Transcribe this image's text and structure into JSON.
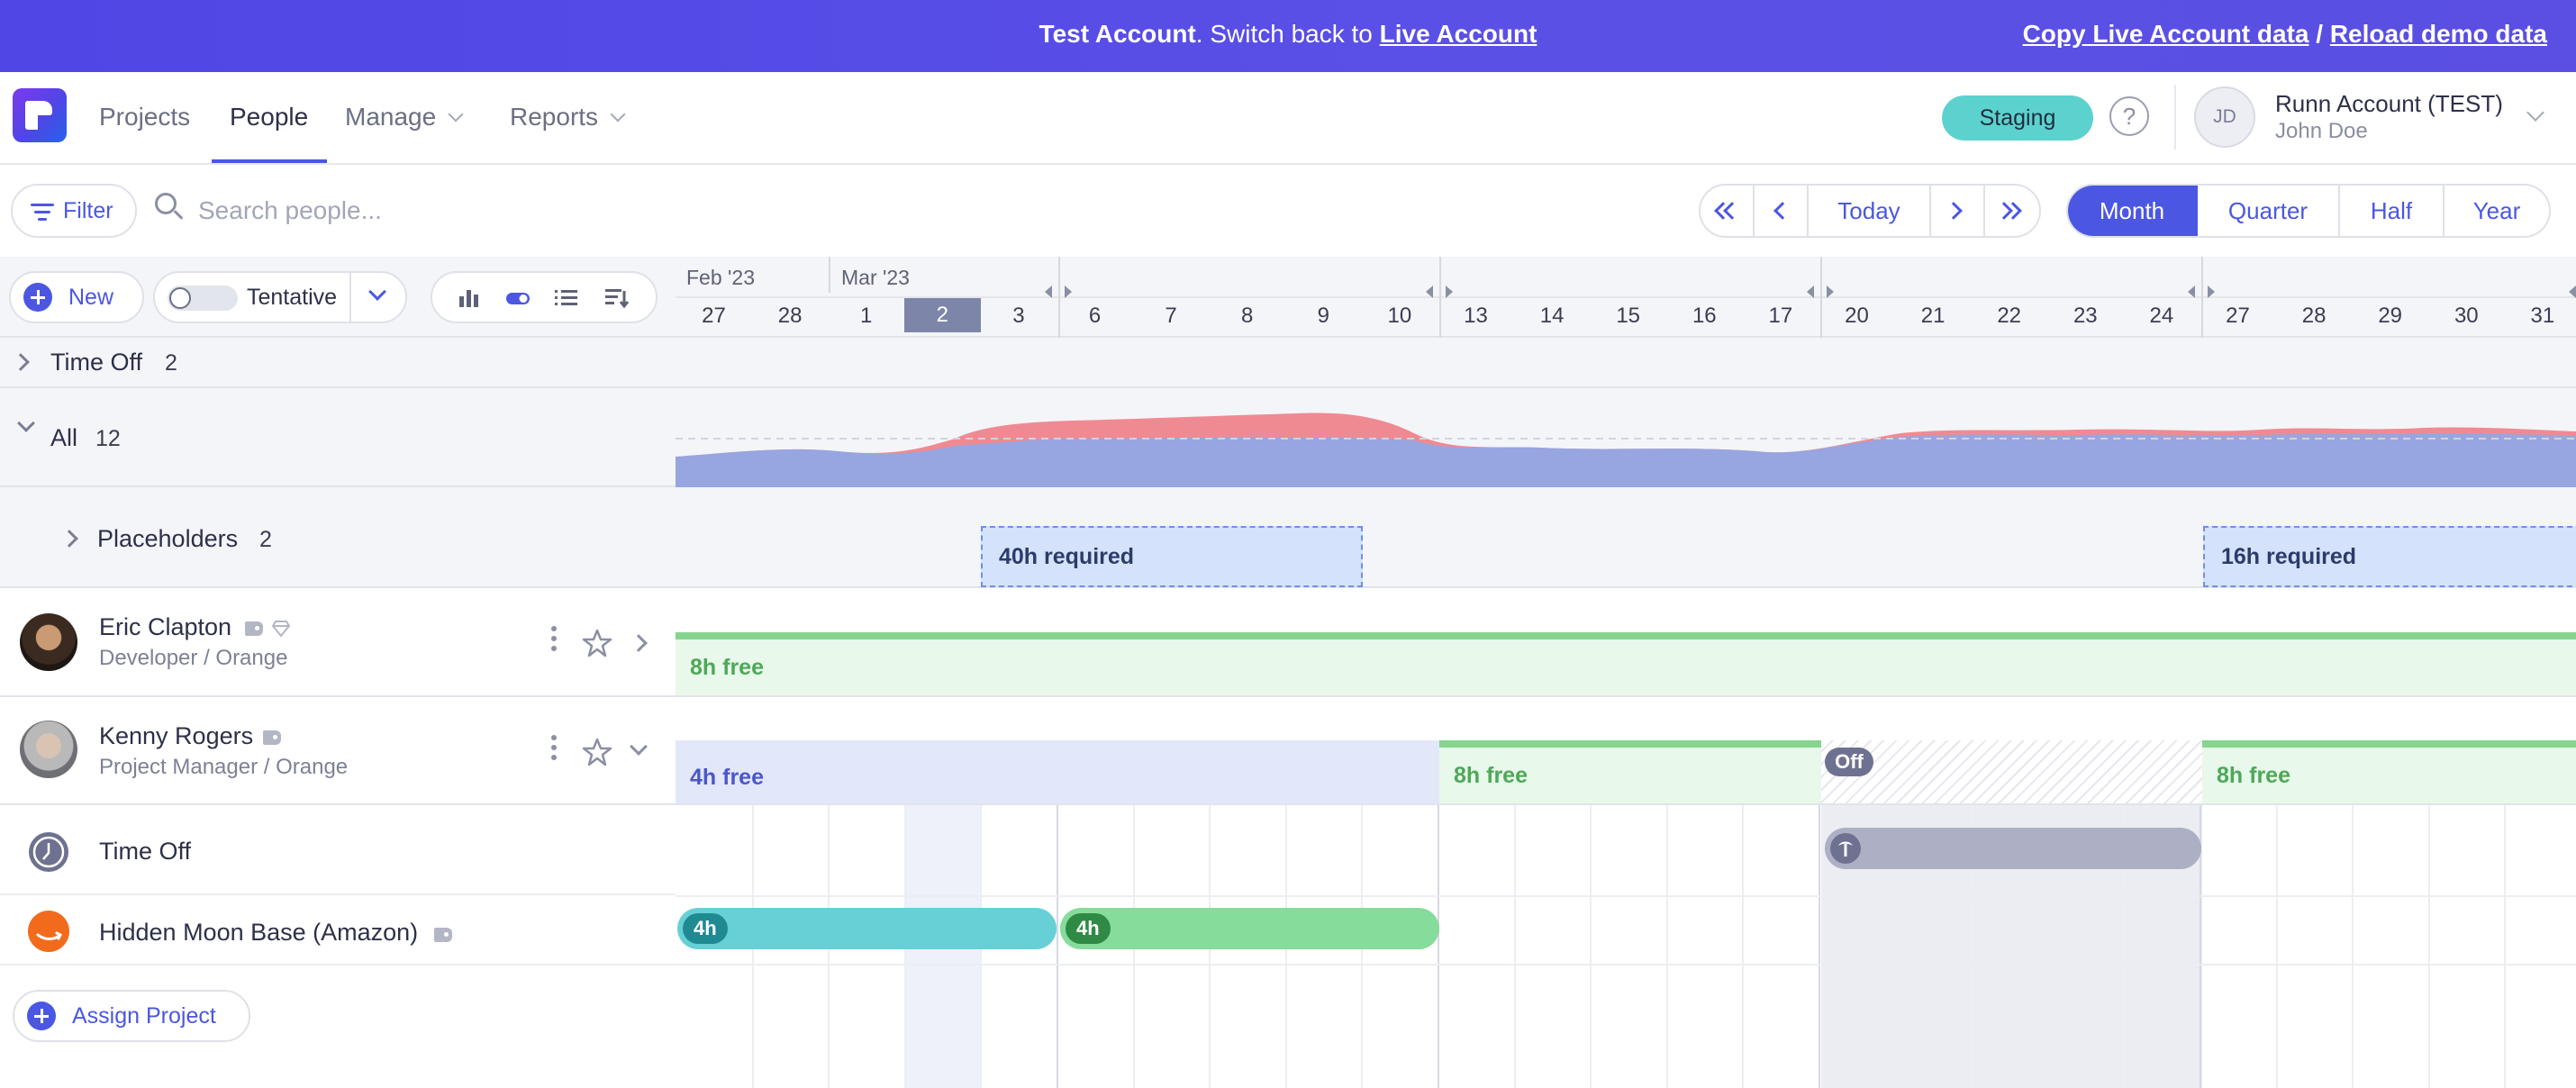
{
  "banner": {
    "test_account": "Test Account",
    "switch_text": ". Switch back to ",
    "live_account": "Live Account",
    "copy_live": "Copy Live Account data",
    "separator": " / ",
    "reload_demo": "Reload demo data"
  },
  "nav": {
    "projects": "Projects",
    "people": "People",
    "manage": "Manage",
    "reports": "Reports",
    "staging": "Staging",
    "help": "?",
    "avatar_initials": "JD",
    "account_name": "Runn Account (TEST)",
    "user_name": "John Doe"
  },
  "toolbar": {
    "filter": "Filter",
    "search_placeholder": "Search people...",
    "today": "Today",
    "scales": [
      "Month",
      "Quarter",
      "Half",
      "Year"
    ],
    "active_scale": "Month"
  },
  "controls": {
    "new": "New",
    "tentative": "Tentative"
  },
  "timeline": {
    "months": [
      {
        "label": "Feb '23"
      },
      {
        "label": "Mar '23"
      }
    ],
    "days": [
      "27",
      "28",
      "1",
      "2",
      "3",
      "6",
      "7",
      "8",
      "9",
      "10",
      "13",
      "14",
      "15",
      "16",
      "17",
      "20",
      "21",
      "22",
      "23",
      "24",
      "27",
      "28",
      "29",
      "30",
      "31"
    ],
    "today_index": 3
  },
  "groups": {
    "time_off": {
      "label": "Time Off",
      "count": "2"
    },
    "all": {
      "label": "All",
      "count": "12"
    },
    "placeholders": {
      "label": "Placeholders",
      "count": "2"
    }
  },
  "placeholders_required": [
    "40h required",
    "16h required"
  ],
  "people": [
    {
      "name": "Eric Clapton",
      "role": "Developer / Orange",
      "availability": [
        "8h free"
      ]
    },
    {
      "name": "Kenny Rogers",
      "role": "Project Manager / Orange",
      "availability": [
        "4h free",
        "8h free",
        "Off",
        "8h free"
      ]
    }
  ],
  "assignments": [
    {
      "label": "Time Off"
    },
    {
      "label": "Hidden Moon Base (Amazon)",
      "bars": [
        "4h",
        "4h"
      ]
    }
  ],
  "assign_project": "Assign Project",
  "colors": {
    "brand": "#4b57e2",
    "banner": "#5048e5",
    "staging": "#5cd2cf",
    "overbooked": "#f08a92",
    "capacity": "#97a6e0",
    "free_green": "#86d48e",
    "project_teal": "#66d0d6",
    "project_green": "#86dc9a"
  },
  "icons": [
    "filter-icon",
    "search-icon",
    "chevron-down-icon",
    "double-chevron-left-icon",
    "chevron-left-icon",
    "chevron-right-icon",
    "double-chevron-right-icon",
    "plus-icon",
    "bar-chart-icon",
    "toggle-icon",
    "list-icon",
    "sort-icon",
    "tag-icon",
    "gem-icon",
    "kebab-icon",
    "star-icon",
    "clock-icon",
    "amazon-icon",
    "palm-tree-icon"
  ]
}
